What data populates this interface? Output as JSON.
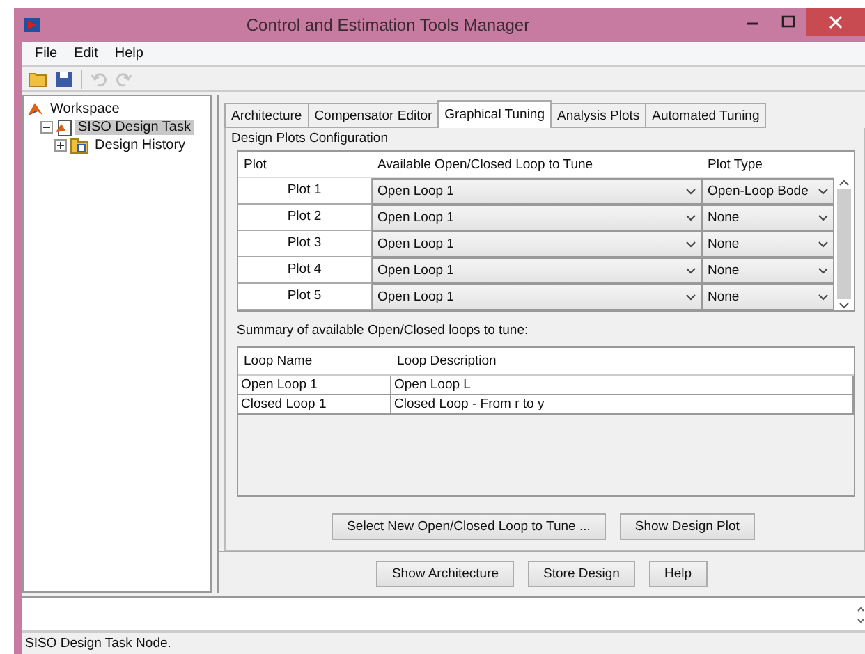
{
  "window": {
    "title": "Control and Estimation Tools Manager"
  },
  "menu": [
    "File",
    "Edit",
    "Help"
  ],
  "toolbar": [
    {
      "kind": "open",
      "disabled": false
    },
    {
      "kind": "save",
      "disabled": false
    },
    {
      "kind": "undo",
      "disabled": true
    },
    {
      "kind": "redo",
      "disabled": true
    }
  ],
  "tree": [
    {
      "label": "Workspace",
      "kind": "matlab",
      "selected": false,
      "children": [
        {
          "label": "SISO Design Task",
          "kind": "task",
          "selected": true,
          "expanded": true,
          "children": [
            {
              "label": "Design History",
              "kind": "history",
              "selected": false,
              "expanded": false
            }
          ]
        }
      ]
    }
  ],
  "tabs": [
    {
      "label": "Architecture",
      "selected": false
    },
    {
      "label": "Compensator Editor",
      "selected": false
    },
    {
      "label": "Graphical Tuning",
      "selected": true
    },
    {
      "label": "Analysis Plots",
      "selected": false
    },
    {
      "label": "Automated Tuning",
      "selected": false
    }
  ],
  "plots_config": {
    "title": "Design Plots Configuration",
    "columns": [
      "Plot",
      "Available Open/Closed Loop to Tune",
      "Plot Type"
    ],
    "rows": [
      {
        "plot": "Plot 1",
        "loop": "Open Loop 1",
        "type": "Open-Loop Bode"
      },
      {
        "plot": "Plot 2",
        "loop": "Open Loop 1",
        "type": "None"
      },
      {
        "plot": "Plot 3",
        "loop": "Open Loop 1",
        "type": "None"
      },
      {
        "plot": "Plot 4",
        "loop": "Open Loop 1",
        "type": "None"
      },
      {
        "plot": "Plot 5",
        "loop": "Open Loop 1",
        "type": "None"
      }
    ]
  },
  "summary": {
    "label": "Summary of available Open/Closed loops to tune:",
    "columns": [
      "Loop Name",
      "Loop Description"
    ],
    "rows": [
      {
        "name": "Open Loop 1",
        "description": "Open Loop L"
      },
      {
        "name": "Closed Loop 1",
        "description": "Closed Loop - From r to y"
      }
    ]
  },
  "tab_buttons": [
    "Select New Open/Closed Loop to Tune ...",
    "Show Design Plot"
  ],
  "dialog_buttons": [
    "Show Architecture",
    "Store Design",
    "Help"
  ],
  "status_bar": "SISO Design Task Node."
}
